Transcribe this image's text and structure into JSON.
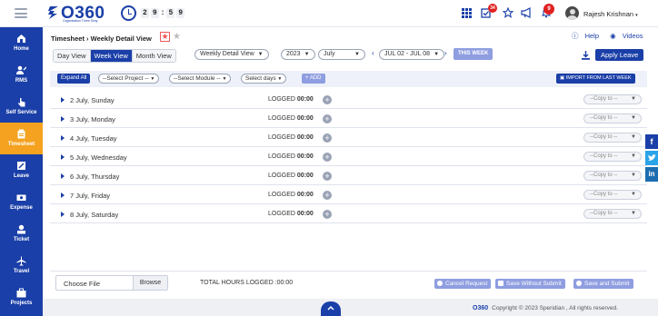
{
  "header": {
    "logo_text": "O360",
    "logo_tagline": "Organization Three Sixty",
    "timer": [
      "2",
      "9",
      "5",
      "9"
    ],
    "notification_badge_1": "34",
    "notification_badge_2": "9",
    "user_name": "Rajesh Krishnan",
    "icons": [
      "menu-icon",
      "apps-grid-icon",
      "tasks-icon",
      "star-icon",
      "megaphone-icon",
      "bell-icon",
      "user-avatar-icon"
    ]
  },
  "sidebar": {
    "items": [
      {
        "label": "Home",
        "icon": "home-icon",
        "active": false
      },
      {
        "label": "RMS",
        "icon": "rms-icon",
        "active": false
      },
      {
        "label": "Self Service",
        "icon": "self-service-icon",
        "active": false
      },
      {
        "label": "Timesheet",
        "icon": "timesheet-icon",
        "active": true
      },
      {
        "label": "Leave",
        "icon": "leave-icon",
        "active": false
      },
      {
        "label": "Expense",
        "icon": "expense-icon",
        "active": false
      },
      {
        "label": "Ticket",
        "icon": "ticket-icon",
        "active": false
      },
      {
        "label": "Travel",
        "icon": "travel-icon",
        "active": false
      },
      {
        "label": "Projects",
        "icon": "projects-icon",
        "active": false
      }
    ]
  },
  "breadcrumb": "Timesheet › Weekly Detail View",
  "help": {
    "help_label": "Help",
    "videos_label": "Videos"
  },
  "tabs": [
    "Day View",
    "Week View",
    "Month View"
  ],
  "active_tab": "Week View",
  "view_select": "Weekly Detail View",
  "year_select": "2023",
  "month_select": "July",
  "week_range": "JUL 02 - JUL 08",
  "this_week_label": "THIS WEEK",
  "apply_leave_label": "Apply Leave",
  "filters": {
    "expand_all": "Expand All",
    "project": "--Select Project --",
    "module": "--Select Module --",
    "days": "Select days",
    "add": "+ ADD",
    "import": "IMPORT FROM LAST WEEK"
  },
  "days": [
    {
      "label": "2 July, Sunday",
      "logged_label": "LOGGED",
      "logged_value": "00:00",
      "copy_placeholder": "--Copy to --"
    },
    {
      "label": "3 July, Monday",
      "logged_label": "LOGGED",
      "logged_value": "00:00",
      "copy_placeholder": "--Copy to --"
    },
    {
      "label": "4 July, Tuesday",
      "logged_label": "LOGGED",
      "logged_value": "00:00",
      "copy_placeholder": "--Copy to --"
    },
    {
      "label": "5 July, Wednesday",
      "logged_label": "LOGGED",
      "logged_value": "00:00",
      "copy_placeholder": "--Copy to --"
    },
    {
      "label": "6 July, Thursday",
      "logged_label": "LOGGED",
      "logged_value": "00:00",
      "copy_placeholder": "--Copy to --"
    },
    {
      "label": "7 July, Friday",
      "logged_label": "LOGGED",
      "logged_value": "00:00",
      "copy_placeholder": "--Copy to --"
    },
    {
      "label": "8 July, Saturday",
      "logged_label": "LOGGED",
      "logged_value": "00:00",
      "copy_placeholder": "--Copy to --"
    }
  ],
  "footer": {
    "choose_file": "Choose File",
    "browse": "Browse",
    "total_hours": "TOTAL HOURS LOGGED :00:00",
    "cancel_request": "Cancel Request",
    "save_without_submit": "Save Without Submit",
    "save_and_submit": "Save and Submit"
  },
  "copyright": {
    "brand": "O360",
    "text": "Copyright © 2023 Speridian , All rights reserved."
  },
  "colors": {
    "primary": "#1b3fa8",
    "active_sidebar": "#f4a21f",
    "secondary_button": "#8f9ee0",
    "badge": "#e02020"
  }
}
